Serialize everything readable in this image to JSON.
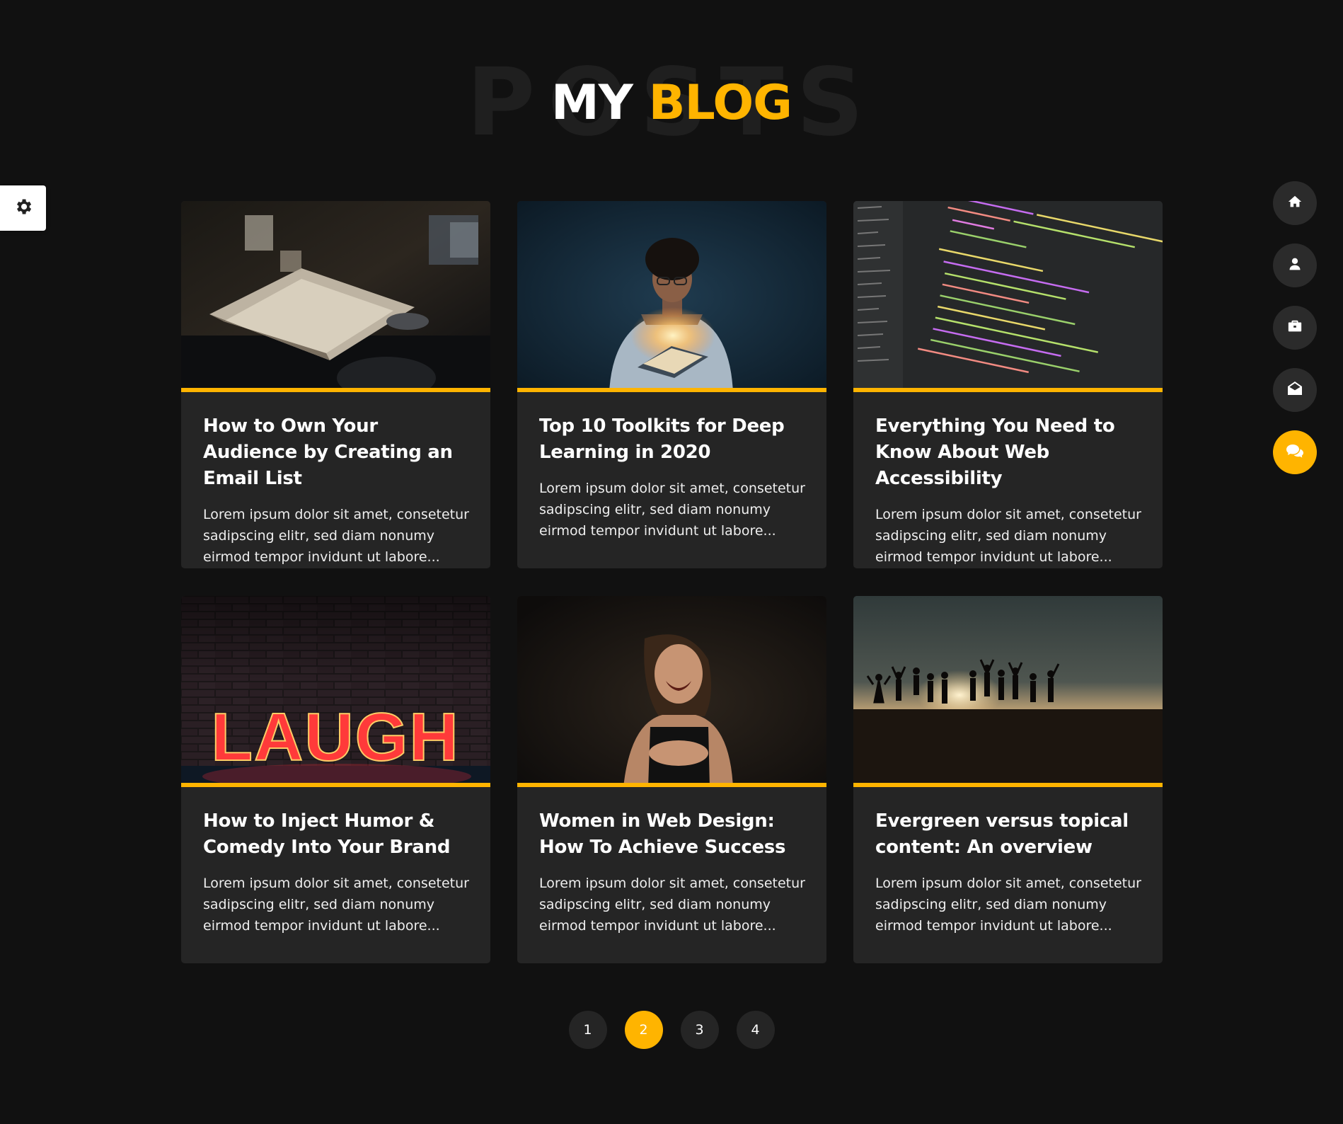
{
  "header": {
    "background_word": "POSTS",
    "title_part1": "MY",
    "title_part2": "BLOG"
  },
  "colors": {
    "accent": "#ffb400",
    "background": "#111111",
    "card": "#252525"
  },
  "settings": {
    "icon": "gear-icon"
  },
  "nav": [
    {
      "icon": "home-icon",
      "active": false
    },
    {
      "icon": "user-icon",
      "active": false
    },
    {
      "icon": "briefcase-icon",
      "active": false
    },
    {
      "icon": "envelope-open-icon",
      "active": false
    },
    {
      "icon": "comments-icon",
      "active": true
    }
  ],
  "posts": [
    {
      "title": "How to Own Your Audience by Creating an Email List",
      "excerpt": "Lorem ipsum dolor sit amet, consetetur sadipscing elitr, sed diam nonumy eirmod tempor invidunt ut labore..."
    },
    {
      "title": "Top 10 Toolkits for Deep Learning in 2020",
      "excerpt": "Lorem ipsum dolor sit amet, consetetur sadipscing elitr, sed diam nonumy eirmod tempor invidunt ut labore..."
    },
    {
      "title": "Everything You Need to Know About Web Accessibility",
      "excerpt": "Lorem ipsum dolor sit amet, consetetur sadipscing elitr, sed diam nonumy eirmod tempor invidunt ut labore..."
    },
    {
      "title": "How to Inject Humor & Comedy Into Your Brand",
      "excerpt": "Lorem ipsum dolor sit amet, consetetur sadipscing elitr, sed diam nonumy eirmod tempor invidunt ut labore...",
      "image_text": "LAUGH"
    },
    {
      "title": "Women in Web Design: How To Achieve Success",
      "excerpt": "Lorem ipsum dolor sit amet, consetetur sadipscing elitr, sed diam nonumy eirmod tempor invidunt ut labore..."
    },
    {
      "title": "Evergreen versus topical content: An overview",
      "excerpt": "Lorem ipsum dolor sit amet, consetetur sadipscing elitr, sed diam nonumy eirmod tempor invidunt ut labore..."
    }
  ],
  "pagination": {
    "pages": [
      "1",
      "2",
      "3",
      "4"
    ],
    "current": "2"
  }
}
